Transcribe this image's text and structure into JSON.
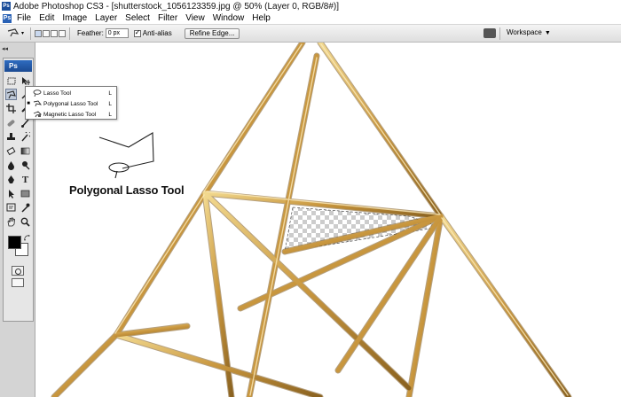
{
  "window": {
    "app_icon": "photoshop-icon",
    "title": "Adobe Photoshop CS3 - [shutterstock_1056123359.jpg @ 50% (Layer 0, RGB/8#)]"
  },
  "menu": {
    "app_badge": "Ps",
    "items": [
      "File",
      "Edit",
      "Image",
      "Layer",
      "Select",
      "Filter",
      "View",
      "Window",
      "Help"
    ]
  },
  "options_bar": {
    "feather_label": "Feather:",
    "feather_value": "0 px",
    "anti_alias_label": "Anti-alias",
    "anti_alias_checked": true,
    "refine_edge_label": "Refine Edge...",
    "workspace_label": "Workspace"
  },
  "toolbox": {
    "logo": "Ps",
    "collapse_glyph": "◂◂",
    "foreground_color": "#000000",
    "background_color": "#ffffff"
  },
  "flyout": {
    "items": [
      {
        "label": "Lasso Tool",
        "shortcut": "L",
        "selected": false,
        "icon": "lasso-icon"
      },
      {
        "label": "Polygonal Lasso Tool",
        "shortcut": "L",
        "selected": true,
        "icon": "polygonal-lasso-icon"
      },
      {
        "label": "Magnetic Lasso Tool",
        "shortcut": "L",
        "selected": false,
        "icon": "magnetic-lasso-icon"
      }
    ]
  },
  "annotation": {
    "label": "Polygonal Lasso Tool"
  },
  "colors": {
    "gold_light": "#e8c878",
    "gold_mid": "#c89a42",
    "gold_dark": "#8a6220",
    "photoshop_blue": "#1c4e9a"
  }
}
